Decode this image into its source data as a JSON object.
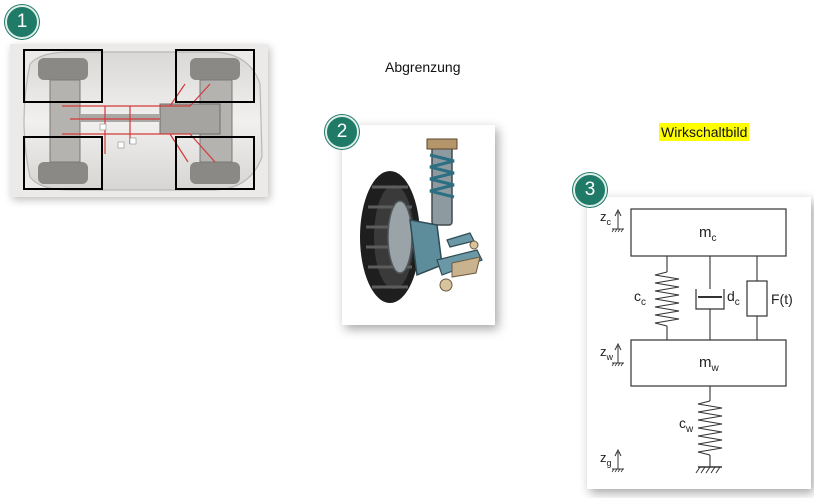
{
  "badges": {
    "one": "1",
    "two": "2",
    "three": "3"
  },
  "captions": {
    "abgrenzung": "Abgrenzung",
    "wirkschaltbild": "Wirkschaltbild"
  },
  "model": {
    "mass_chassis": "m",
    "mass_chassis_sub": "c",
    "mass_wheel": "m",
    "mass_wheel_sub": "w",
    "spring_chassis": "c",
    "spring_chassis_sub": "c",
    "damper": "d",
    "damper_sub": "c",
    "force": "F(t)",
    "spring_tire": "c",
    "spring_tire_sub": "w",
    "z_c": "z",
    "z_c_sub": "c",
    "z_w": "z",
    "z_w_sub": "w",
    "z_g": "z",
    "z_g_sub": "g"
  },
  "colors": {
    "accent": "#1f7a68",
    "highlight": "#ffff00"
  }
}
